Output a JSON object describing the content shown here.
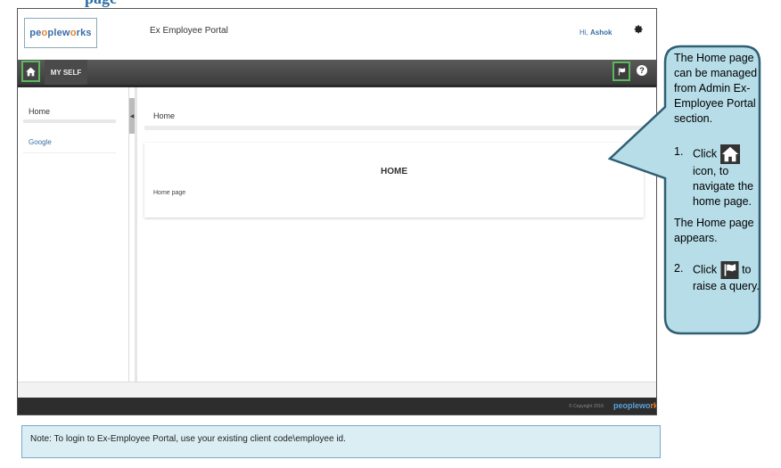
{
  "heading_fragment": "page",
  "app": {
    "logo_main": "pe",
    "logo_accent": "o",
    "logo_rest": "ple",
    "logo_w": "w",
    "logo_o2": "o",
    "logo_end": "rks",
    "portal_title": "Ex Employee Portal",
    "greeting_prefix": "Hi,",
    "greeting_name": "Ashok"
  },
  "nav": {
    "myself_label": "MY SELF",
    "help_glyph": "?"
  },
  "sidebar": {
    "items": [
      {
        "label": "Home"
      },
      {
        "label": "Google"
      }
    ]
  },
  "content": {
    "breadcrumb": "Home",
    "card_title": "HOME",
    "card_body": "Home page"
  },
  "footer": {
    "copyright": "© Copyright 2016",
    "logo_text": "peoplewo",
    "logo_accent": "rks"
  },
  "callout": {
    "intro": "The Home page can be managed from Admin Ex-Employee Portal section.",
    "step1_num": "1.",
    "step1_click": "Click",
    "step1_rest": "icon, to navigate the home page.",
    "after_step1": "The Home page appears.",
    "step2_num": "2.",
    "step2_click": "Click",
    "step2_to": "to",
    "step2_rest": "raise a query."
  },
  "note": {
    "text": "Note: To login to  Ex-Employee Portal, use your existing client code\\employee id."
  },
  "colors": {
    "callout_fill": "#b7dde8",
    "callout_stroke": "#2f5f73",
    "highlight_green": "#5cb85c",
    "nav_dark": "#3b3b3b",
    "link_blue": "#3a6ea8",
    "note_fill": "#dbeef4"
  }
}
